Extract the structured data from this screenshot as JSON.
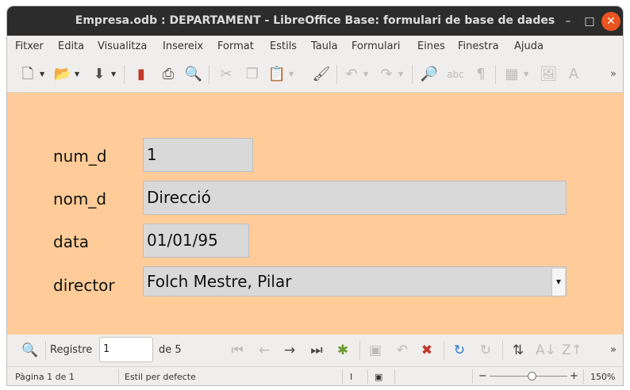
{
  "window": {
    "title": "Empresa.odb : DEPARTAMENT - LibreOffice Base: formulari de base de dades",
    "controls": {
      "minimize": "–",
      "maximize": "□",
      "close": "✕"
    }
  },
  "menu": [
    "Fitxer",
    "Edita",
    "Visualitza",
    "Insereix",
    "Format",
    "Estils",
    "Taula",
    "Formulari",
    "Eines",
    "Finestra",
    "Ajuda"
  ],
  "form": {
    "background": "#ffcc99",
    "fields": [
      {
        "label": "num_d",
        "value": "1"
      },
      {
        "label": "nom_d",
        "value": "Direcció"
      },
      {
        "label": "data",
        "value": "01/01/95"
      },
      {
        "label": "director",
        "value": "Folch Mestre, Pilar"
      }
    ]
  },
  "navigation": {
    "record_label": "Registre",
    "record_value": "1",
    "of_label": "de 5"
  },
  "status": {
    "page": "Pàgina 1 de 1",
    "style": "Estil per defecte",
    "zoom": "150%",
    "zoom_minus": "−",
    "zoom_plus": "+"
  }
}
